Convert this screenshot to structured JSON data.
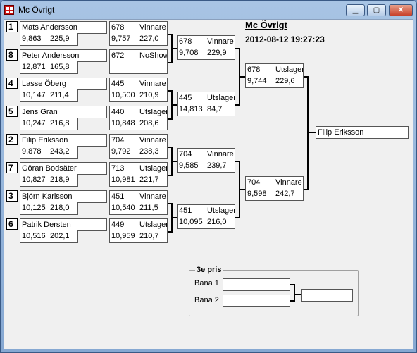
{
  "window": {
    "title": "Mc Övrigt",
    "min_label": "▁",
    "max_label": "▢",
    "close_label": "✕"
  },
  "header": {
    "title": "Mc Övrigt",
    "timestamp": "2012-08-12 19:27:23"
  },
  "round1": [
    {
      "seed": "1",
      "name": "Mats Andersson",
      "rt": "9,863",
      "sp": "225,9",
      "num": "678",
      "res": "Vinnare",
      "et": "9,757",
      "es": "227,0"
    },
    {
      "seed": "8",
      "name": "Peter Andersson",
      "rt": "12,871",
      "sp": "165,8",
      "num": "672",
      "res": "NoShow",
      "et": "",
      "es": ""
    },
    {
      "seed": "4",
      "name": "Lasse Öberg",
      "rt": "10,147",
      "sp": "211,4",
      "num": "445",
      "res": "Vinnare",
      "et": "10,500",
      "es": "210,9"
    },
    {
      "seed": "5",
      "name": "Jens Gran",
      "rt": "10,247",
      "sp": "216,8",
      "num": "440",
      "res": "Utslagen",
      "et": "10,848",
      "es": "208,6"
    },
    {
      "seed": "2",
      "name": "Filip Eriksson",
      "rt": "9,878",
      "sp": "243,2",
      "num": "704",
      "res": "Vinnare",
      "et": "9,792",
      "es": "238,3"
    },
    {
      "seed": "7",
      "name": "Göran Bodsäter",
      "rt": "10,827",
      "sp": "218,9",
      "num": "713",
      "res": "Utslagen",
      "et": "10,981",
      "es": "221,7"
    },
    {
      "seed": "3",
      "name": "Björn Karlsson",
      "rt": "10,125",
      "sp": "218,0",
      "num": "451",
      "res": "Vinnare",
      "et": "10,540",
      "es": "211,5"
    },
    {
      "seed": "6",
      "name": "Patrik Dersten",
      "rt": "10,516",
      "sp": "202,1",
      "num": "449",
      "res": "Utslagen",
      "et": "10,959",
      "es": "210,7"
    }
  ],
  "round2": [
    {
      "num": "678",
      "res": "Vinnare",
      "et": "9,708",
      "es": "229,9"
    },
    {
      "num": "445",
      "res": "Utslagen",
      "et": "14,813",
      "es": "84,7"
    },
    {
      "num": "704",
      "res": "Vinnare",
      "et": "9,585",
      "es": "239,7"
    },
    {
      "num": "451",
      "res": "Utslagen",
      "et": "10,095",
      "es": "216,0"
    }
  ],
  "round3": [
    {
      "num": "678",
      "res": "Utslagen",
      "et": "9,744",
      "es": "229,6"
    },
    {
      "num": "704",
      "res": "Vinnare",
      "et": "9,598",
      "es": "242,7"
    }
  ],
  "final": {
    "winner": "Filip Eriksson"
  },
  "third_place": {
    "title": "3e pris",
    "lane1": "Bana 1",
    "lane2": "Bana 2"
  }
}
